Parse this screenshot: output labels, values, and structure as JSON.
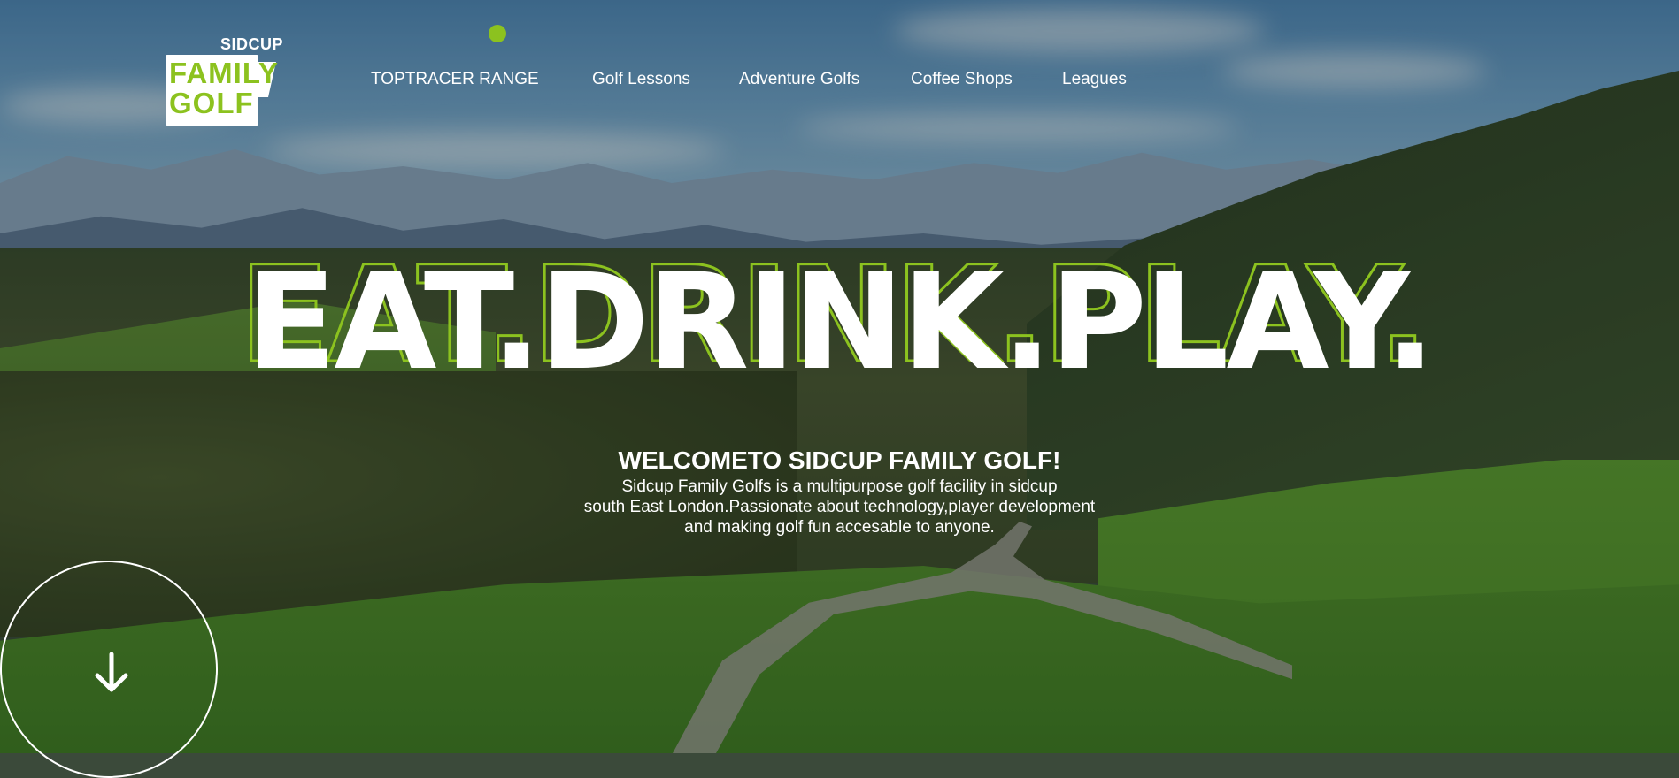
{
  "brand": {
    "logo_top": "SIDCUP",
    "logo_line1": "FAMILY",
    "logo_line2": "GOLF",
    "accent_color": "#8cc21f"
  },
  "nav": {
    "items": [
      {
        "label": "TOPTRACER RANGE"
      },
      {
        "label": "Golf Lessons"
      },
      {
        "label": "Adventure Golfs"
      },
      {
        "label": "Coffee Shops"
      },
      {
        "label": "Leagues"
      }
    ]
  },
  "hero": {
    "title": "EAT.DRINK.PLAY.",
    "welcome": "WELCOMETO SIDCUP FAMILY GOLF!",
    "description_lines": [
      "Sidcup Family Golfs is a multipurpose golf facility in sidcup",
      "south East London.Passionate about technology,player development",
      "and making golf fun accesable to anyone."
    ]
  },
  "scroll": {
    "icon": "arrow-down-icon"
  }
}
